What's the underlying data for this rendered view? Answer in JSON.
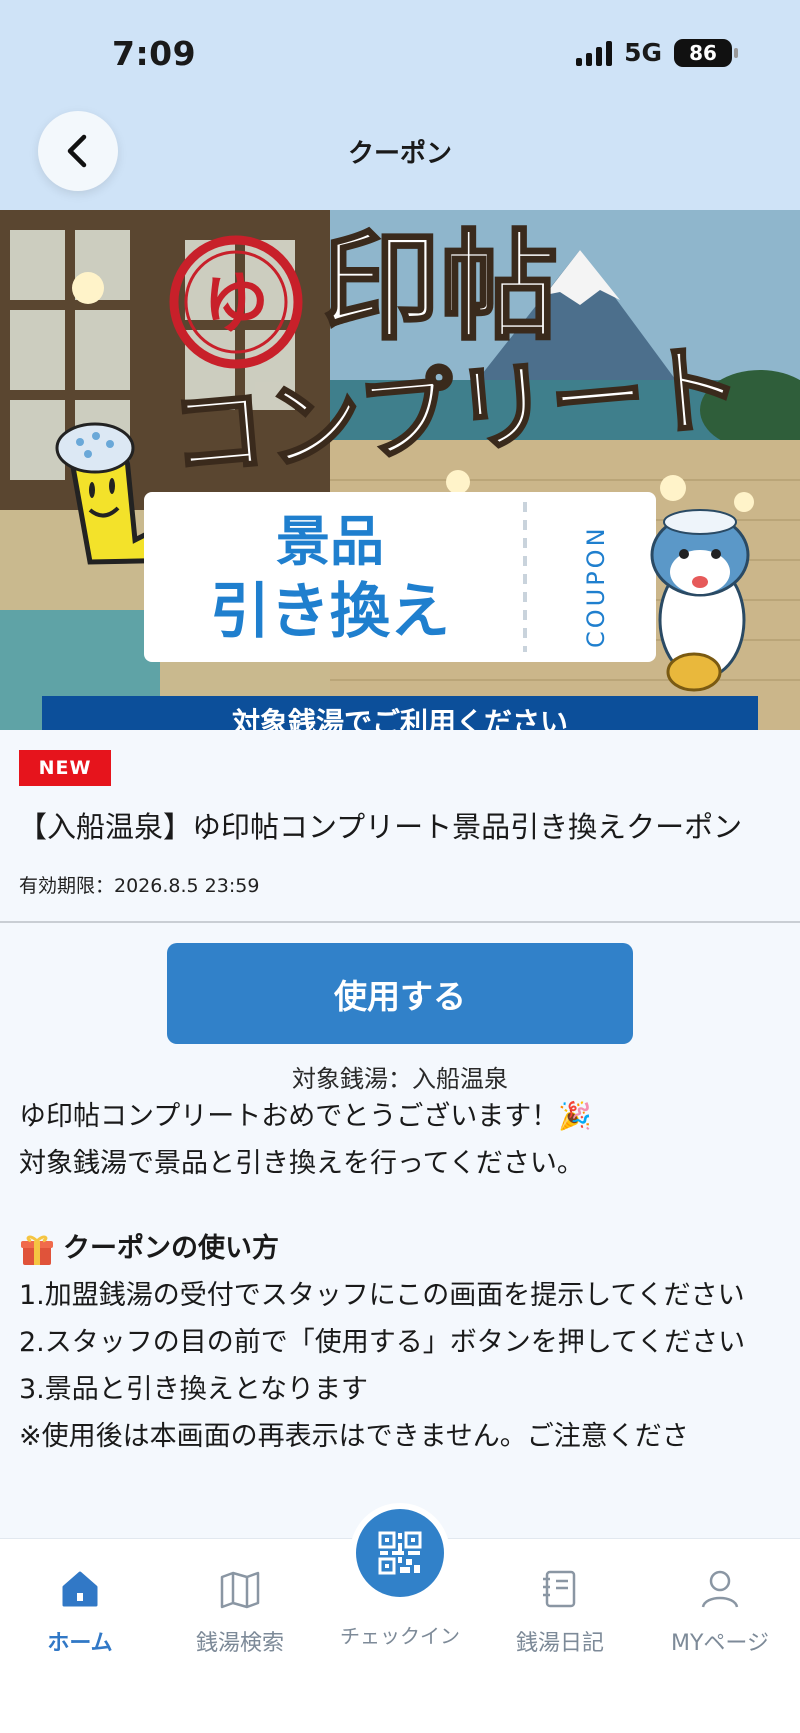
{
  "status_bar": {
    "time": "7:09",
    "network": "5G",
    "battery": "86"
  },
  "header": {
    "title": "クーポン"
  },
  "banner": {
    "headline": "印帖",
    "sub_headline": "コンプリート",
    "seal_char": "ゆ",
    "ticket_line1": "景品",
    "ticket_line2": "引き換え",
    "ticket_coupon": "COUPON",
    "strip_text": "対象銭湯でご利用ください"
  },
  "coupon": {
    "badge": "NEW",
    "title": "【入船温泉】ゆ印帖コンプリート景品引き換えクーポン",
    "expiry": "有効期限：2026.8.5 23:59",
    "use_button": "使用する",
    "target": "対象銭湯：入船温泉"
  },
  "description": {
    "line1": "ゆ印帖コンプリートおめでとうございます！🎉",
    "line2": "対象銭湯で景品と引き換えを行ってください。",
    "howto_heading": "クーポンの使い方",
    "step1": "1.加盟銭湯の受付でスタッフにこの画面を提示してください",
    "step2": "2.スタッフの目の前で「使用する」ボタンを押してください",
    "step3": "3.景品と引き換えとなります",
    "note": "※使用後は本画面の再表示はできません。ご注意くださ"
  },
  "nav": {
    "home": "ホーム",
    "search": "銭湯検索",
    "checkin": "チェックイン",
    "diary": "銭湯日記",
    "mypage": "MYページ"
  },
  "colors": {
    "accent": "#3181c9",
    "badge": "#e6141c",
    "header_bg": "#cfe3f7"
  }
}
